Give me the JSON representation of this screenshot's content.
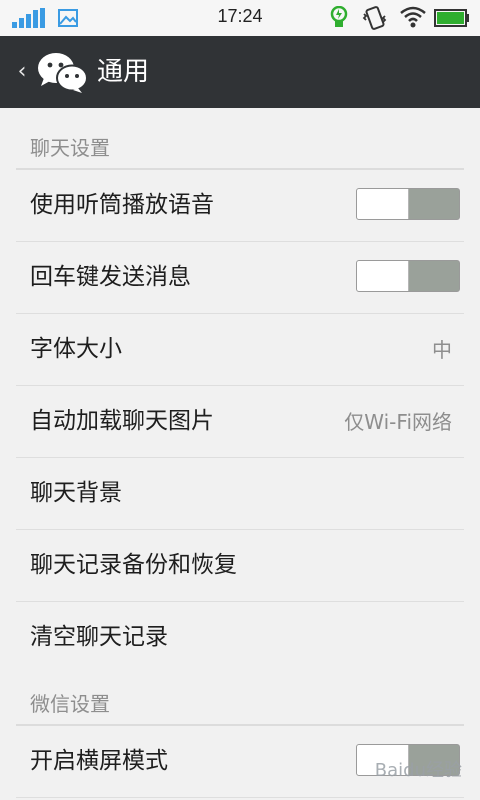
{
  "status_bar": {
    "time": "17:24",
    "icons": [
      "signal-icon",
      "image-icon",
      "battery-saver-icon",
      "vibrate-icon",
      "wifi-icon",
      "battery-icon"
    ],
    "accent_blue": "#3a9be3",
    "accent_green": "#2fae2f"
  },
  "header": {
    "title": "通用",
    "background": "#303336"
  },
  "sections": [
    {
      "title": "聊天设置",
      "rows": [
        {
          "label": "使用听筒播放语音",
          "control": "toggle",
          "state": "off"
        },
        {
          "label": "回车键发送消息",
          "control": "toggle",
          "state": "off"
        },
        {
          "label": "字体大小",
          "value": "中"
        },
        {
          "label": "自动加载聊天图片",
          "value": "仅Wi-Fi网络"
        },
        {
          "label": "聊天背景"
        },
        {
          "label": "聊天记录备份和恢复"
        },
        {
          "label": "清空聊天记录"
        }
      ]
    },
    {
      "title": "微信设置",
      "rows": [
        {
          "label": "开启横屏模式",
          "control": "toggle",
          "state": "off"
        }
      ]
    }
  ],
  "watermark": "Baidu经验"
}
